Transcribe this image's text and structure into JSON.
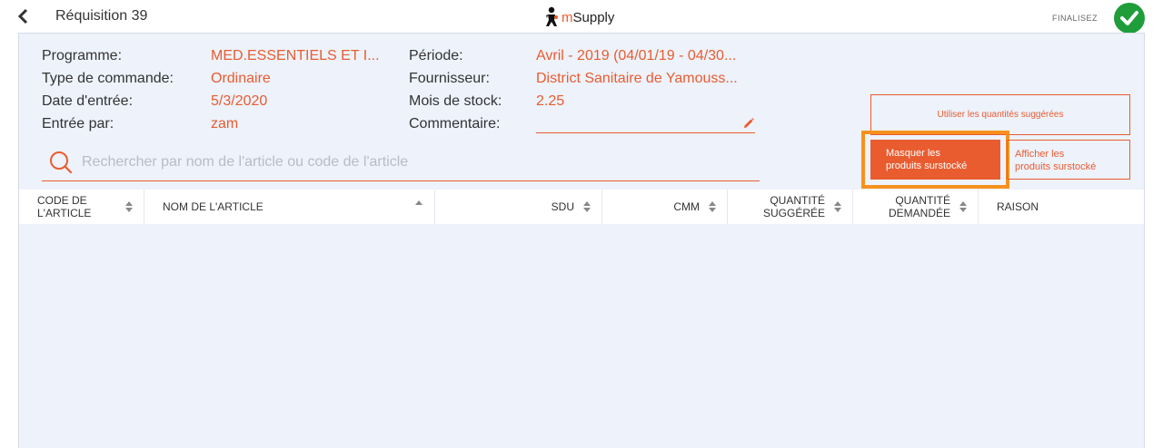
{
  "header": {
    "title": "Réquisition 39",
    "brand": "mSupply",
    "finalise_label": "FINALISEZ"
  },
  "info": {
    "programme": {
      "label": "Programme:",
      "value": "MED.ESSENTIELS ET I..."
    },
    "order_type": {
      "label": "Type de commande:",
      "value": "Ordinaire"
    },
    "entry_date": {
      "label": "Date d'entrée:",
      "value": "5/3/2020"
    },
    "entered_by": {
      "label": "Entrée par:",
      "value": "zam"
    },
    "period": {
      "label": "Période:",
      "value": "Avril - 2019 (04/01/19 - 04/30..."
    },
    "supplier": {
      "label": "Fournisseur:",
      "value": "District Sanitaire de Yamouss..."
    },
    "months_stock": {
      "label": "Mois de stock:",
      "value": "2.25"
    },
    "comment": {
      "label": "Commentaire:",
      "value": ""
    }
  },
  "search": {
    "placeholder": "Rechercher par nom de l'article ou code de l'article"
  },
  "buttons": {
    "use_suggested": "Utiliser les quantités suggérées",
    "hide_overstocked_1": "Masquer les",
    "hide_overstocked_2": "produits surstocké",
    "show_overstocked_1": "Afficher les",
    "show_overstocked_2": "produits surstocké"
  },
  "table": {
    "col_code_1": "CODE DE",
    "col_code_2": "L'ARTICLE",
    "col_name": "NOM DE L'ARTICLE",
    "col_sdu": "SDU",
    "col_cmm": "CMM",
    "col_suggested_1": "QUANTITÉ",
    "col_suggested_2": "SUGGÉRÉE",
    "col_requested_1": "QUANTITÉ",
    "col_requested_2": "DEMANDÉE",
    "col_reason": "RAISON",
    "rows": []
  },
  "colors": {
    "accent": "#e95c30",
    "highlight": "#f7911e",
    "success": "#1f9d3b",
    "panel": "#edf2fb"
  }
}
